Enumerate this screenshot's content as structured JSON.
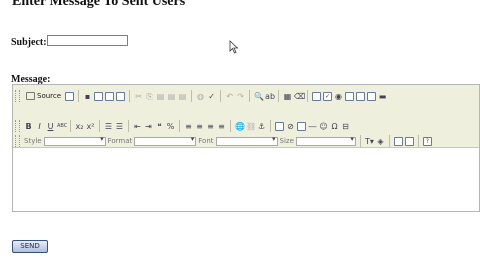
{
  "page": {
    "title": "Enter Message To Sent Users"
  },
  "form": {
    "subject_label": "Subject:",
    "subject_value": "",
    "message_label": "Message:",
    "send_label": "SEND"
  },
  "editor": {
    "source_label": "Source",
    "format_labels": {
      "style": "Style",
      "format": "Format",
      "font": "Font",
      "size": "Size"
    },
    "toolbar_row1": [
      "source",
      "save",
      "new-page",
      "preview",
      "templates",
      "cut",
      "copy",
      "paste",
      "paste-text",
      "paste-word",
      "print",
      "spell-check",
      "undo",
      "redo",
      "find",
      "replace",
      "select-all",
      "remove-format",
      "form",
      "checkbox",
      "radio",
      "text-field",
      "textarea",
      "select",
      "button"
    ],
    "toolbar_row2": [
      "bold",
      "italic",
      "underline",
      "strike",
      "subscript",
      "superscript",
      "numbered-list",
      "bulleted-list",
      "outdent",
      "indent",
      "blockquote",
      "div",
      "align-left",
      "align-center",
      "align-right",
      "justify",
      "link",
      "unlink",
      "anchor",
      "image",
      "flash",
      "table",
      "horizontal-rule",
      "smiley",
      "special-char",
      "page-break"
    ],
    "toolbar_row3": [
      "text-color",
      "background-color",
      "maximize",
      "show-blocks",
      "about"
    ]
  },
  "colors": {
    "toolbar_bg": "#efefde",
    "send_button_border": "#3b4f7a",
    "send_button_bg": "#aebfdb"
  }
}
